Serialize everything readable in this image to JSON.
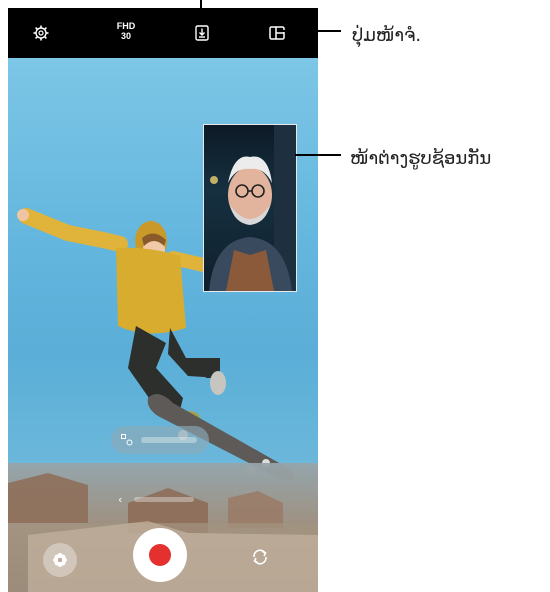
{
  "topbar": {
    "settings_icon": "gear-icon",
    "resolution_line1": "FHD",
    "resolution_line2": "30",
    "save_icon": "download-icon",
    "layout_icon": "split-view-icon"
  },
  "callouts": {
    "view_button_label": "ປຸ່ມໜ້າຈໍ.",
    "overlay_label": "ໜ້າຕ່າງຮູບຊ້ອນກັນ"
  },
  "controls": {
    "mode_chevron": "‹",
    "effects_icon": "flower-icon",
    "switch_icon": "camera-switch-icon"
  },
  "colors": {
    "record": "#e5312d",
    "topbar": "#000000"
  }
}
